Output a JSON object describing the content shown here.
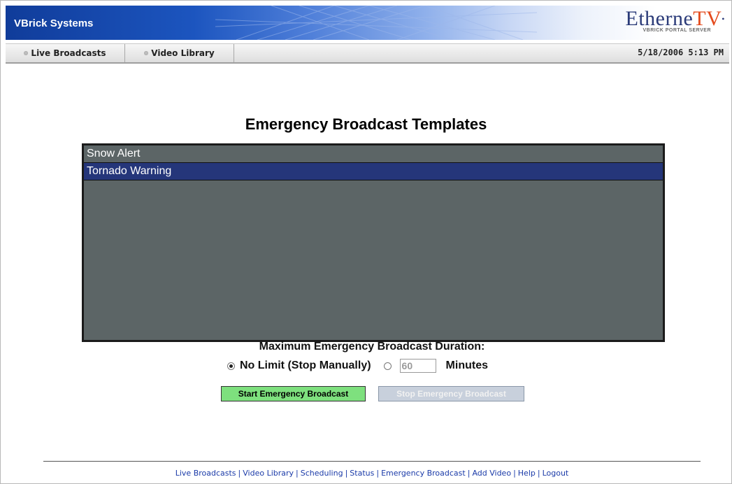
{
  "header": {
    "brand": "VBrick Systems",
    "logo_main": "Etherne",
    "logo_tv": "TV",
    "logo_sub": "VBRICK PORTAL SERVER"
  },
  "nav": {
    "tabs": [
      {
        "label": "Live Broadcasts"
      },
      {
        "label": "Video Library"
      }
    ],
    "datetime": "5/18/2006 5:13 PM"
  },
  "main": {
    "title": "Emergency Broadcast Templates",
    "templates": [
      {
        "label": "Snow Alert",
        "selected": false
      },
      {
        "label": "Tornado Warning",
        "selected": true
      }
    ],
    "duration_label": "Maximum Emergency Broadcast Duration:",
    "option_no_limit": "No Limit (Stop Manually)",
    "option_minutes_value": "60",
    "option_minutes_unit": "Minutes",
    "selected_option": "no_limit",
    "start_button": "Start Emergency Broadcast",
    "stop_button": "Stop Emergency Broadcast"
  },
  "footer": {
    "links": [
      {
        "label": "Live Broadcasts"
      },
      {
        "label": "Video Library"
      },
      {
        "label": "Scheduling"
      },
      {
        "label": "Status"
      },
      {
        "label": "Emergency Broadcast"
      },
      {
        "label": "Add Video"
      },
      {
        "label": "Help"
      },
      {
        "label": "Logout"
      }
    ],
    "separator": "|"
  },
  "colors": {
    "header_blue": "#103c9a",
    "listbox_bg": "#5c6566",
    "selected_row": "#25367a",
    "start_button": "#7ee07e",
    "stop_button_disabled": "#c8d0dc",
    "link": "#1a3aa8",
    "logo_tv": "#e44a1c"
  },
  "icons": {
    "nav_bullet": "bullet-icon"
  }
}
